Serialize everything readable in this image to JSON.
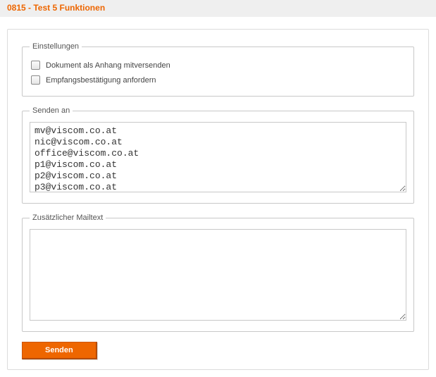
{
  "header": {
    "title": "0815 - Test 5 Funktionen"
  },
  "settings": {
    "legend": "Einstellungen",
    "attach_doc_label": "Dokument als Anhang mitversenden",
    "attach_doc_checked": false,
    "read_receipt_label": "Empfangsbestätigung anfordern",
    "read_receipt_checked": false
  },
  "send_to": {
    "legend": "Senden an",
    "value": "mv@viscom.co.at\nnic@viscom.co.at\noffice@viscom.co.at\np1@viscom.co.at\np2@viscom.co.at\np3@viscom.co.at"
  },
  "extra_text": {
    "legend": "Zusätzlicher Mailtext",
    "value": ""
  },
  "actions": {
    "send_label": "Senden"
  },
  "colors": {
    "accent": "#ee6600"
  }
}
